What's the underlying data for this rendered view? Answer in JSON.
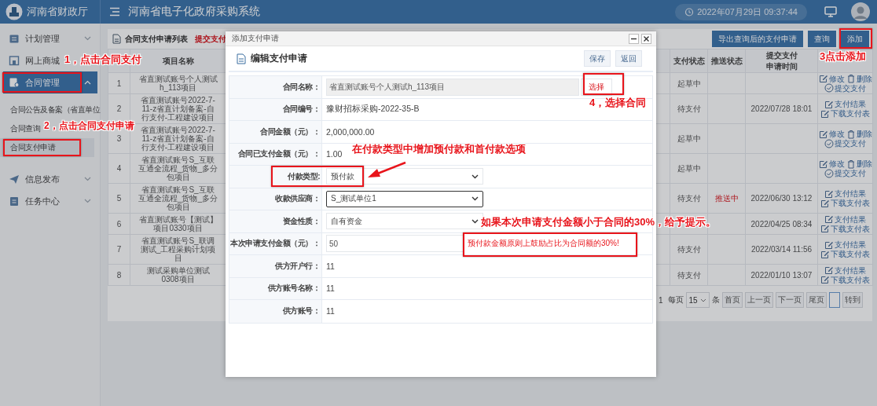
{
  "header": {
    "org": "河南省财政厅",
    "system_title": "河南省电子化政府采购系统",
    "datetime": "2022年07月29日 09:37:44"
  },
  "sidebar": {
    "items": [
      {
        "label": "计划管理",
        "expanded": false,
        "selected": false
      },
      {
        "label": "网上商城",
        "selected": false
      },
      {
        "label": "合同管理",
        "expanded": true,
        "selected": true,
        "children": [
          {
            "label": "合同公告及备案（省直单位",
            "selected": false
          },
          {
            "label": "合同查询",
            "selected": false
          },
          {
            "label": "合同支付申请",
            "selected": true
          }
        ]
      },
      {
        "label": "信息发布",
        "expanded": false,
        "selected": false
      },
      {
        "label": "任务中心",
        "expanded": false,
        "selected": false
      }
    ]
  },
  "page": {
    "title": "合同支付申请列表",
    "subtitle": "提交支付",
    "buttons": [
      "导出查询后的支付申请",
      "查询",
      "添加"
    ]
  },
  "table": {
    "columns": [
      "项目名称",
      "支付状态",
      "推送状态",
      "提交支付申请时间"
    ],
    "rows": [
      {
        "no": "1",
        "name": "省直测试账号个人测试h_113项目",
        "pay_status": "起草中",
        "actions": [
          {
            "label": "修改",
            "kind": "edit"
          },
          {
            "label": "删除",
            "kind": "delete"
          },
          {
            "label": "提交支付",
            "kind": "submit"
          }
        ]
      },
      {
        "no": "2",
        "name": "省直测试账号2022-7-11-z省直计划备案-自行支付-工程建设项目",
        "pay_status": "待支付",
        "submitted": "2022/07/28 18:01",
        "actions": [
          {
            "label": "支付结果",
            "kind": "edit"
          },
          {
            "label": "下载支付表",
            "kind": "edit"
          }
        ]
      },
      {
        "no": "3",
        "name": "省直测试账号2022-7-11-z省直计划备案-自行支付-工程建设项目",
        "pay_status": "起草中",
        "actions": [
          {
            "label": "修改",
            "kind": "edit"
          },
          {
            "label": "删除",
            "kind": "delete"
          },
          {
            "label": "提交支付",
            "kind": "submit"
          }
        ]
      },
      {
        "no": "4",
        "name": "省直测试账号S_互联互通全流程_货物_多分包项目",
        "pay_status": "起草中",
        "actions": [
          {
            "label": "修改",
            "kind": "edit"
          },
          {
            "label": "删除",
            "kind": "delete"
          },
          {
            "label": "提交支付",
            "kind": "submit"
          }
        ]
      },
      {
        "no": "5",
        "name": "省直测试账号S_互联互通全流程_货物_多分包项目",
        "pay_status": "待支付",
        "push_status": "推送中",
        "submitted": "2022/06/30 13:12",
        "actions": [
          {
            "label": "支付结果",
            "kind": "edit"
          },
          {
            "label": "下载支付表",
            "kind": "edit"
          }
        ]
      },
      {
        "no": "6",
        "name": "省直测试账号【测试】项目0330项目",
        "submitted": "2022/04/25 08:34",
        "actions": [
          {
            "label": "支付结果",
            "kind": "edit"
          },
          {
            "label": "下载支付表",
            "kind": "edit"
          }
        ]
      },
      {
        "no": "7",
        "name": "省直测试账号S_联调测试_工程采购计划项目",
        "pay_status": "待支付",
        "submitted": "2022/03/14 11:56",
        "actions": [
          {
            "label": "支付结果",
            "kind": "edit"
          },
          {
            "label": "下载支付表",
            "kind": "edit"
          }
        ]
      },
      {
        "no": "8",
        "name": "测试采购单位测试0308项目",
        "pay_status": "待支付",
        "submitted": "2022/01/10 13:07",
        "actions": [
          {
            "label": "支付结果",
            "kind": "edit"
          },
          {
            "label": "下载支付表",
            "kind": "edit"
          }
        ]
      }
    ]
  },
  "pagination": {
    "count": "1",
    "per_page_label": "每页",
    "per_page": "15",
    "unit": "条",
    "buttons": [
      "首页",
      "上一页",
      "下一页",
      "尾页"
    ],
    "go": "转到"
  },
  "modal": {
    "title": "添加支付申请",
    "heading": "编辑支付申请",
    "buttons": [
      "保存",
      "返回"
    ],
    "fields": [
      {
        "label": "合同名称：",
        "kind": "picker",
        "value": "省直测试账号个人测试h_113项目",
        "button": "选择"
      },
      {
        "label": "合同编号：",
        "kind": "text",
        "value": "豫财招标采购-2022-35-B"
      },
      {
        "label": "合同金额（元）：",
        "kind": "text",
        "value": "2,000,000.00"
      },
      {
        "label": "合同已支付金额（元）：",
        "kind": "text",
        "value": "1.00"
      },
      {
        "label": "付款类型:",
        "kind": "select",
        "value": "预付款",
        "focused": false
      },
      {
        "label": "收款供应商：",
        "kind": "select",
        "value": "S_测试单位1",
        "focused": true
      },
      {
        "label": "资金性质：",
        "kind": "select",
        "value": "自有资金",
        "focused": false
      },
      {
        "label": "本次申请支付金额（元）：",
        "kind": "input",
        "value": "50",
        "hint": "预付款金额原则上鼓励占比为合同额的30%!"
      },
      {
        "label": "供方开户行：",
        "kind": "text",
        "value": "11"
      },
      {
        "label": "供方账号名称：",
        "kind": "text",
        "value": "11"
      },
      {
        "label": "供方账号：",
        "kind": "text",
        "value": "11"
      }
    ]
  },
  "annotations": [
    "1，点击合同支付",
    "2，点击合同支付申请",
    "3点击添加",
    "4，选择合同",
    "在付款类型中增加预付款和首付款选项",
    "如果本次申请支付金额小于合同的30%，给予提示。"
  ]
}
